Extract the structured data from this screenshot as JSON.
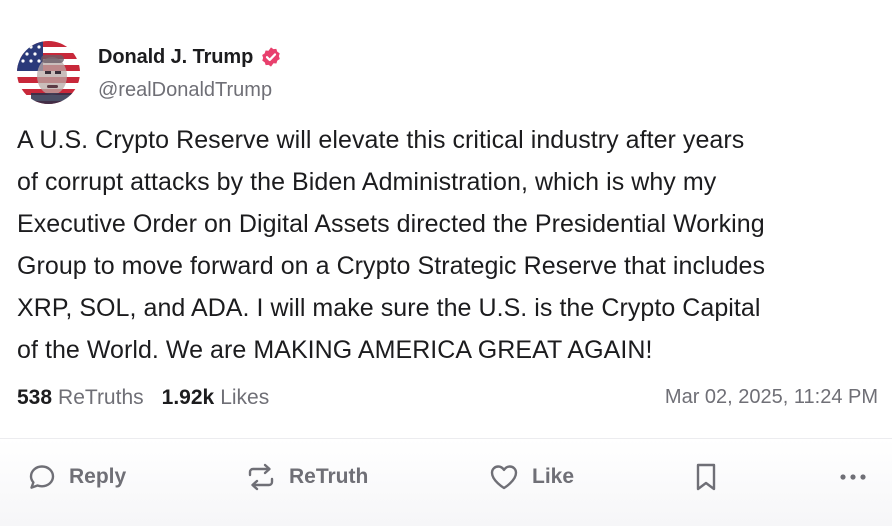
{
  "author": {
    "display_name": "Donald J. Trump",
    "handle": "@realDonaldTrump",
    "verified_icon": "verified-badge-icon",
    "verified_color": "#e8406d"
  },
  "post": {
    "lines": [
      "A U.S. Crypto Reserve will elevate this critical industry after years",
      "of corrupt attacks by the Biden Administration, which is why my",
      "Executive Order on Digital Assets directed the Presidential Working",
      "Group to move forward on a Crypto Strategic Reserve that includes",
      "XRP, SOL, and ADA. I will make sure the U.S. is the Crypto Capital",
      "of the World. We are MAKING AMERICA GREAT AGAIN!"
    ]
  },
  "stats": {
    "retruths_count": "538",
    "retruths_label": "ReTruths",
    "likes_count": "1.92k",
    "likes_label": "Likes",
    "timestamp": "Mar 02, 2025, 11:24 PM"
  },
  "actions": {
    "reply_label": "Reply",
    "retruth_label": "ReTruth",
    "like_label": "Like",
    "icons": [
      "reply-icon",
      "retruth-icon",
      "like-icon",
      "bookmark-icon",
      "more-options-icon"
    ]
  },
  "colors": {
    "text": "#1c1c1e",
    "muted": "#6f6f76",
    "accent": "#e8406d"
  }
}
